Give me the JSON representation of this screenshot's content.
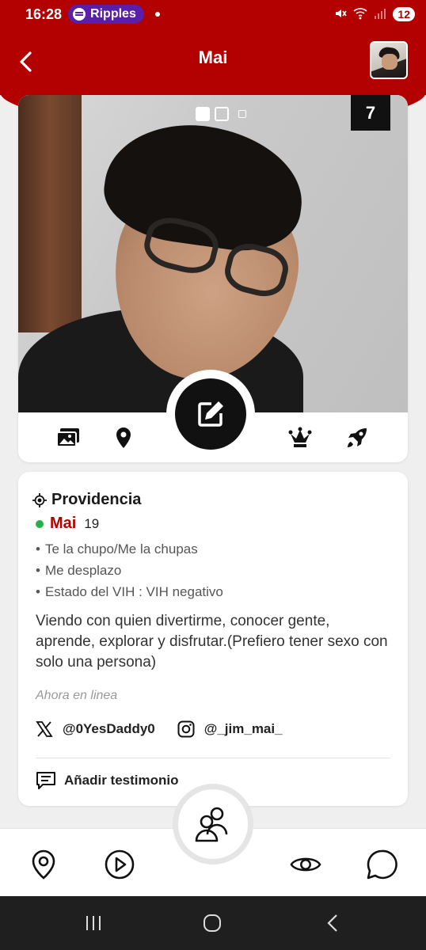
{
  "status_bar": {
    "time": "16:28",
    "media_pill": "Ripples",
    "battery": "12"
  },
  "header": {
    "title": "Mai"
  },
  "photo": {
    "count": "7"
  },
  "profile": {
    "location": "Providencia",
    "name": "Mai",
    "age": "19",
    "details": [
      "Te la chupo/Me la chupas",
      "Me desplazo",
      "Estado del VIH : VIH negativo"
    ],
    "bio": "Viendo con quien divertirme, conocer gente, aprende, explorar y disfrutar.(Prefiero tener sexo con solo una persona)",
    "status": "Ahora en linea",
    "twitter": "@0YesDaddy0",
    "instagram": "@_jim_mai_",
    "testimonial_label": "Añadir testimonio"
  },
  "colors": {
    "brand": "#b30000",
    "online": "#22b14c"
  },
  "icons": {
    "photo_actions": [
      "gallery-icon",
      "location-pin-icon",
      "edit-icon",
      "crown-icon",
      "rocket-icon"
    ],
    "bottom_nav": [
      "location-icon",
      "play-icon",
      "people-icon",
      "eye-icon",
      "chat-icon"
    ]
  }
}
